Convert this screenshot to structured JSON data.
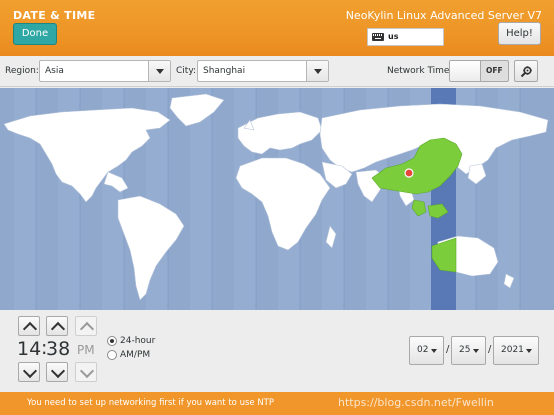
{
  "header": {
    "title": "DATE & TIME",
    "done_label": "Done",
    "product": "NeoKylin Linux Advanced Server V7",
    "keyboard_layout": "us",
    "help_label": "Help!"
  },
  "toolbar": {
    "region_label": "Region:",
    "region_value": "Asia",
    "city_label": "City:",
    "city_value": "Shanghai",
    "network_time_label": "Network Time",
    "network_time_state": "OFF"
  },
  "map": {
    "ocean_color": "#8fa8cc",
    "land_color": "#ffffff",
    "selected_zone_color": "#7ccd3c",
    "timezone_strip_color": "#5879b5",
    "marker_color": "#e8463b"
  },
  "time": {
    "hours": "14",
    "separator": ":",
    "minutes": "38",
    "ampm": "PM",
    "format_24h_label": "24-hour",
    "format_ampm_label": "AM/PM",
    "format_selected": "24-hour"
  },
  "date": {
    "month": "02",
    "day": "25",
    "year": "2021",
    "separator": "/"
  },
  "warning": {
    "message": "You need to set up networking first if you want to use NTP"
  },
  "watermark": "https://blog.csdn.net/Fwellin",
  "colors": {
    "header": "#ee9526",
    "done_button": "#2fa7a4",
    "warning": "#f0962a"
  }
}
